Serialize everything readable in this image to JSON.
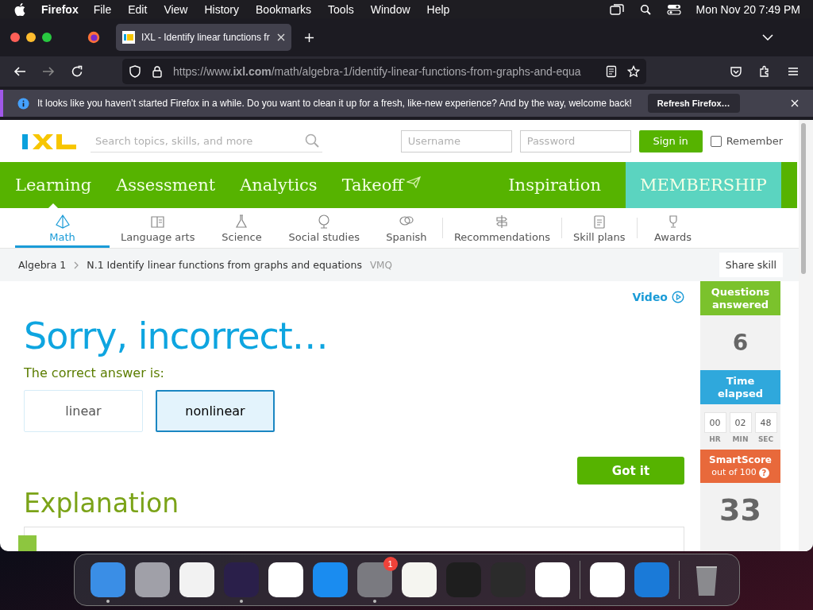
{
  "menubar": {
    "app": "Firefox",
    "menus": [
      "File",
      "Edit",
      "View",
      "History",
      "Bookmarks",
      "Tools",
      "Window",
      "Help"
    ],
    "clock": "Mon Nov 20  7:49 PM"
  },
  "tabs": [
    {
      "title": "IXL - Identify linear functions fr",
      "selected": true
    }
  ],
  "url": "https://www.**ixl.com**/math/algebra-1/identify-linear-functions-from-graphs-and-equa",
  "notification": {
    "message": "It looks like you haven’t started Firefox in a while. Do you want to clean it up for a fresh, like-new experience? And by the way, welcome back!",
    "button": "Refresh Firefox…"
  },
  "header": {
    "search_placeholder": "Search topics, skills, and more",
    "username_placeholder": "Username",
    "password_placeholder": "Password",
    "sign_in": "Sign in",
    "remember": {
      "label": "Remember",
      "checked": false
    }
  },
  "main_nav_left": [
    {
      "label": "Learning",
      "selected": true
    },
    {
      "label": "Assessment",
      "selected": false
    },
    {
      "label": "Analytics",
      "selected": false
    },
    {
      "label": "Takeoff",
      "selected": false
    }
  ],
  "main_nav_right": [
    {
      "label": "Inspiration",
      "kind": "link"
    },
    {
      "label": "MEMBERSHIP",
      "kind": "membership"
    }
  ],
  "subjects": [
    {
      "label": "Math",
      "selected": true
    },
    {
      "label": "Language arts",
      "selected": false
    },
    {
      "label": "Science",
      "selected": false
    },
    {
      "label": "Social studies",
      "selected": false
    },
    {
      "label": "Spanish",
      "selected": false
    },
    {
      "label": "Recommendations",
      "selected": false
    },
    {
      "label": "Skill plans",
      "selected": false
    },
    {
      "label": "Awards",
      "selected": false
    }
  ],
  "breadcrumb": {
    "items": [
      "Algebra 1",
      "N.1 Identify linear functions from graphs and equations"
    ],
    "code": "VMQ",
    "share": "Share skill"
  },
  "video": "Video",
  "feedback": {
    "heading": "Sorry, incorrect…",
    "prompt": "The correct answer is:",
    "choices": [
      {
        "label": "linear",
        "selected": false
      },
      {
        "label": "nonlinear",
        "selected": true
      }
    ],
    "button": "Got it"
  },
  "explanation": {
    "heading": "Explanation"
  },
  "stats": {
    "questions_label": "Questions answered",
    "questions": "6",
    "time_label": "Time elapsed",
    "time": [
      {
        "value": "00",
        "unit": "HR"
      },
      {
        "value": "02",
        "unit": "MIN"
      },
      {
        "value": "48",
        "unit": "SEC"
      }
    ],
    "smartscore_label": "SmartScore",
    "smartscore_sub": "out of 100",
    "help": "?",
    "score": "33"
  },
  "dock": {
    "apps": [
      {
        "running": true
      },
      {
        "running": false
      },
      {
        "running": false
      },
      {
        "running": true
      },
      {
        "running": false
      },
      {
        "running": false
      },
      {
        "running": true,
        "badge": "1"
      },
      {
        "running": false
      },
      {
        "running": false
      },
      {
        "running": false
      },
      {
        "running": false
      }
    ],
    "recent": [
      {
        "running": false
      },
      {
        "running": false
      }
    ]
  }
}
